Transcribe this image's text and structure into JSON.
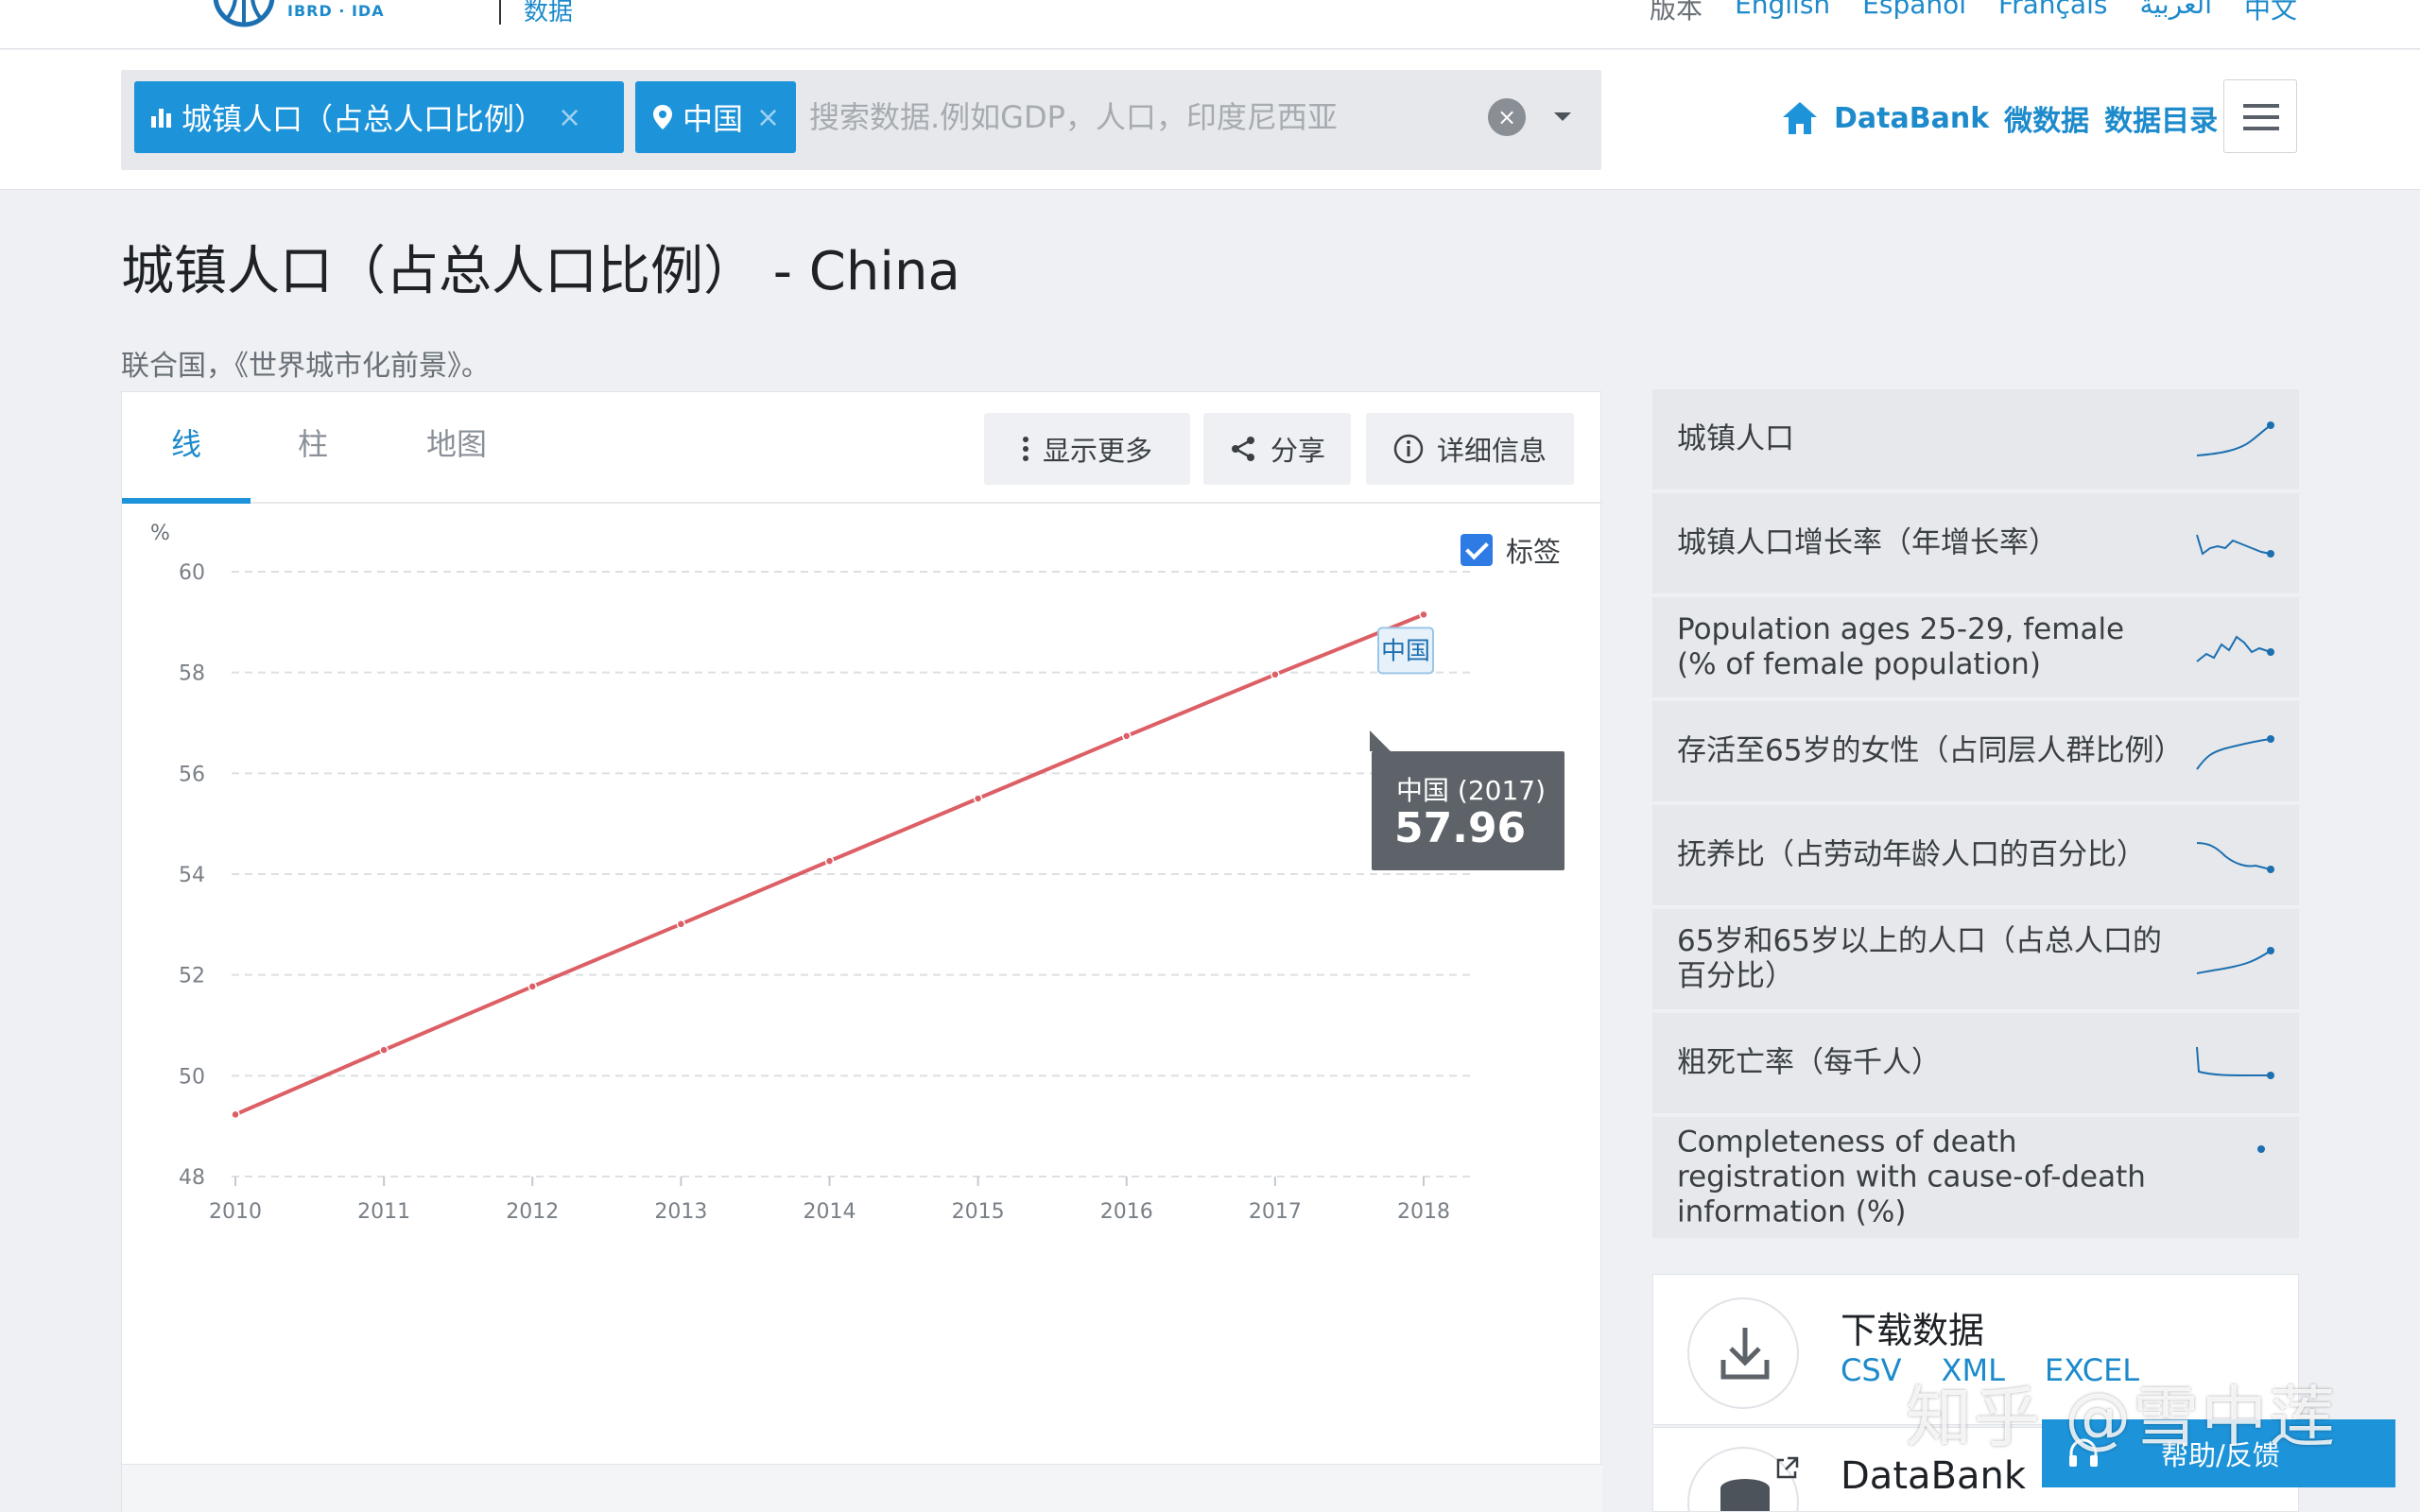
{
  "topbar": {
    "logo_text": "IBRD · IDA",
    "section": "数据",
    "languages": [
      "版本",
      "English",
      "Español",
      "Français",
      "العربية",
      "中文"
    ]
  },
  "search": {
    "chip_indicator": "城镇人口（占总人口比例）",
    "chip_country": "中国",
    "chip_close": "×",
    "placeholder": "搜索数据.例如GDP，人口，印度尼西亚",
    "clear": "×"
  },
  "header_links": {
    "databank": "DataBank",
    "microdata": "微数据",
    "catalog": "数据目录"
  },
  "page": {
    "title": "城镇人口（占总人口比例） - China",
    "source": "联合国，《世界城市化前景》。"
  },
  "tabs": [
    {
      "label": "线"
    },
    {
      "label": "柱"
    },
    {
      "label": "地图"
    }
  ],
  "tools": {
    "more": "显示更多",
    "share": "分享",
    "details": "详细信息",
    "labels_toggle": "标签"
  },
  "tooltip": {
    "label": "中国 (2017)",
    "value": "57.96"
  },
  "chart_data": {
    "type": "line",
    "ylabel": "%",
    "x": [
      2010,
      2011,
      2012,
      2013,
      2014,
      2015,
      2016,
      2017,
      2018
    ],
    "series": [
      {
        "name": "中国",
        "values": [
          49.23,
          50.51,
          51.77,
          53.01,
          54.26,
          55.5,
          56.74,
          57.96,
          59.15
        ]
      }
    ],
    "ylim": [
      48,
      60
    ],
    "yticks": [
      48,
      50,
      52,
      54,
      56,
      58,
      60
    ],
    "grid": true,
    "series_label_position": "end",
    "color": "#dd5f66"
  },
  "related": [
    {
      "label": "城镇人口"
    },
    {
      "label": "城镇人口增长率（年增长率）"
    },
    {
      "label": "Population ages 25-29, female (% of female population)"
    },
    {
      "label": "存活至65岁的女性（占同层人群比例）"
    },
    {
      "label": "抚养比（占劳动年龄人口的百分比）"
    },
    {
      "label": "65岁和65岁以上的人口（占总人口的百分比）"
    },
    {
      "label": "粗死亡率（每千人）"
    },
    {
      "label": "Completeness of death registration with cause-of-death information (%)"
    }
  ],
  "download": {
    "title": "下载数据",
    "csv": "CSV",
    "xml": "XML",
    "excel": "EXCEL"
  },
  "databank_card": {
    "title": "DataBank"
  },
  "help": {
    "label": "帮助/反馈"
  },
  "watermark": "知乎 @雪中莲",
  "colors": {
    "accent": "#1d93d9",
    "line": "#dd5f66",
    "sparkline": "#1c6fb0"
  }
}
